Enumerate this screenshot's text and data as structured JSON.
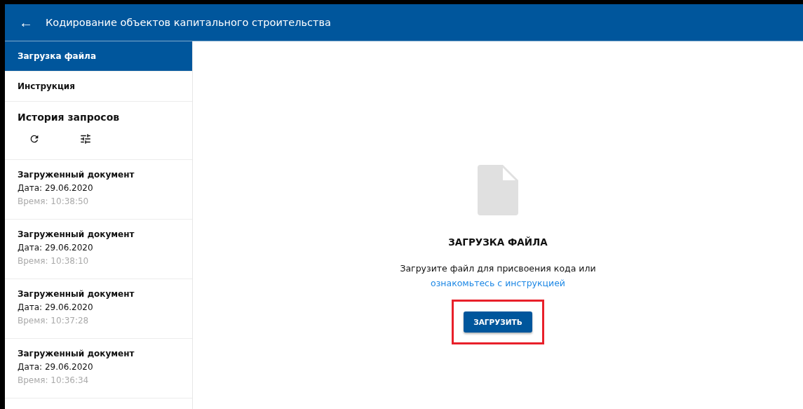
{
  "header": {
    "back": "←",
    "title": "Кодирование объектов капитального строительства"
  },
  "nav": [
    {
      "label": "Загрузка файла",
      "selected": true
    },
    {
      "label": "Инструкция",
      "selected": false
    }
  ],
  "history": {
    "title": "История запросов",
    "items": [
      {
        "name": "Загруженный документ",
        "date": "Дата: 29.06.2020",
        "time": "Время: 10:38:50"
      },
      {
        "name": "Загруженный документ",
        "date": "Дата: 29.06.2020",
        "time": "Время: 10:38:10"
      },
      {
        "name": "Загруженный документ",
        "date": "Дата: 29.06.2020",
        "time": "Время: 10:37:28"
      },
      {
        "name": "Загруженный документ",
        "date": "Дата: 29.06.2020",
        "time": "Время: 10:36:34"
      }
    ]
  },
  "upload": {
    "title": "ЗАГРУЗКА ФАЙЛА",
    "text": "Загрузите файл для присвоения кода или",
    "link": "ознакомьтесь с инструкцией",
    "button": "ЗАГРУЗИТЬ",
    "highlighted": true
  }
}
